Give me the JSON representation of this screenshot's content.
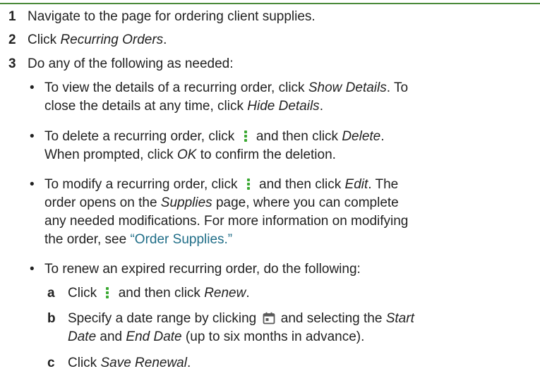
{
  "colors": {
    "rule": "#4a8a3a",
    "link": "#1f6d87",
    "icon_green": "#3aa832",
    "icon_gray": "#5a5a5a"
  },
  "steps": [
    {
      "num": "1",
      "text": "Navigate to the page for ordering client supplies."
    },
    {
      "num": "2",
      "pre": "Click ",
      "em": "Recurring Orders",
      "post": "."
    },
    {
      "num": "3",
      "text": "Do any of the following as needed:"
    }
  ],
  "bullets": {
    "view": {
      "l1_pre": "To view the details of a recurring order, click ",
      "l1_em": "Show Details",
      "l1_post": ". To",
      "l2_pre": "close the details at any time, click ",
      "l2_em": "Hide Details",
      "l2_post": "."
    },
    "delete": {
      "l1_pre": "To delete a recurring order, click ",
      "l1_mid": " and then click ",
      "l1_em": "Delete",
      "l1_post": ".",
      "l2_pre": "When prompted, click ",
      "l2_em": "OK",
      "l2_post": " to confirm the deletion."
    },
    "modify": {
      "l1_pre": "To modify a recurring order, click ",
      "l1_mid": " and then click ",
      "l1_em": "Edit",
      "l1_post": ". The",
      "l2_pre": "order opens on the ",
      "l2_em": "Supplies",
      "l2_post": " page, where you can complete",
      "l3": "any needed modifications. For more information on modifying",
      "l4_pre": "the order, see ",
      "l4_link": "“Order Supplies.”"
    },
    "renew": {
      "text": "To renew an expired recurring order, do the following:",
      "sub": {
        "a": {
          "letter": "a",
          "pre": "Click ",
          "mid": " and then click ",
          "em": "Renew",
          "post": "."
        },
        "b": {
          "letter": "b",
          "l1_pre": "Specify a date range by clicking ",
          "l1_mid": " and selecting the ",
          "l1_em": "Start",
          "l2_em1": "Date",
          "l2_mid": " and ",
          "l2_em2": "End Date",
          "l2_post": " (up to six months in advance)."
        },
        "c": {
          "letter": "c",
          "pre": "Click ",
          "em": "Save Renewal",
          "post": "."
        }
      }
    }
  },
  "icons": {
    "more": "more-vertical-icon",
    "calendar": "calendar-icon"
  }
}
